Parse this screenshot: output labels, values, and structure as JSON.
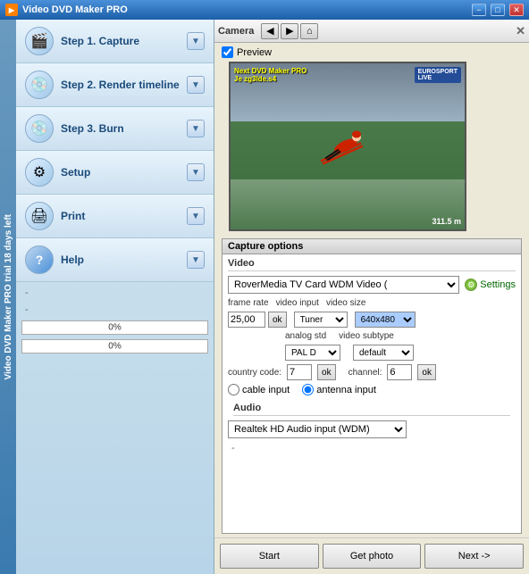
{
  "window": {
    "title": "Video DVD Maker PRO",
    "buttons": {
      "minimize": "−",
      "maximize": "□",
      "close": "✕"
    }
  },
  "sidebar": {
    "vertical_text": "Video DVD Maker PRO trial 18 days left",
    "items": [
      {
        "id": "capture",
        "label": "Step 1. Capture",
        "icon": "🎬"
      },
      {
        "id": "render",
        "label": "Step 2. Render timeline",
        "icon": "💿"
      },
      {
        "id": "burn",
        "label": "Step 3. Burn",
        "icon": "💿"
      },
      {
        "id": "setup",
        "label": "Setup",
        "icon": "⚙"
      },
      {
        "id": "print",
        "label": "Print",
        "icon": "🖨"
      }
    ],
    "help": {
      "label": "Help",
      "icon": "?"
    },
    "dashes": [
      "-",
      "-"
    ],
    "progress_bars": [
      {
        "value": "0%",
        "fill": 0
      },
      {
        "value": "0%",
        "fill": 0
      }
    ]
  },
  "camera_panel": {
    "title": "Camera",
    "toolbar_buttons": [
      "◀",
      "▶",
      "⌂"
    ],
    "close_btn": "✕",
    "preview_checkbox": true,
    "preview_label": "Preview"
  },
  "video_preview": {
    "overlay_text": "Next DVD Maker PRO\nJe zg3lde.s4",
    "logo": "EUROSPORT\nLIVE",
    "distance": "311.5 m"
  },
  "capture_options": {
    "title": "Capture options",
    "video_section_label": "Video",
    "device": "RoverMedia TV Card WDM Video (",
    "settings_label": "Settings",
    "frame_rate_label": "frame rate",
    "frame_rate_value": "25,00",
    "frame_rate_ok": "ok",
    "video_input_label": "video input",
    "video_input_value": "Tuner",
    "video_size_label": "video size",
    "video_size_value": "640x480",
    "analog_std_label": "analog std",
    "analog_std_value": "PAL D",
    "video_subtype_label": "video subtype",
    "video_subtype_value": "default",
    "country_code_label": "country code:",
    "country_code_value": "7",
    "country_code_ok": "ok",
    "channel_label": "channel:",
    "channel_value": "6",
    "channel_ok": "ok",
    "cable_input_label": "cable input",
    "antenna_input_label": "antenna input",
    "audio_section_label": "Audio",
    "audio_device": "Realtek HD Audio input (WDM)",
    "audio_dash": "-"
  },
  "buttons": {
    "start": "Start",
    "get_photo": "Get photo",
    "next": "Next ->"
  }
}
